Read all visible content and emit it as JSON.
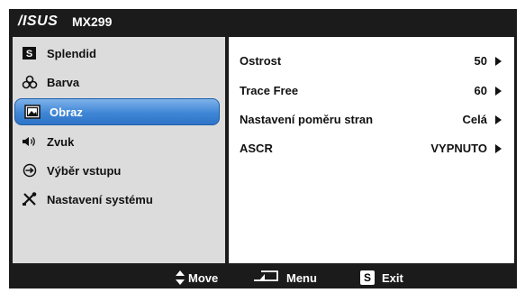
{
  "header": {
    "brand": "/ISUS",
    "model": "MX299"
  },
  "menu": [
    {
      "label": "Splendid",
      "icon": "splendid-s-icon",
      "active": false
    },
    {
      "label": "Barva",
      "icon": "color-icon",
      "active": false
    },
    {
      "label": "Obraz",
      "icon": "image-icon",
      "active": true
    },
    {
      "label": "Zvuk",
      "icon": "speaker-icon",
      "active": false
    },
    {
      "label": "Výběr vstupu",
      "icon": "input-icon",
      "active": false
    },
    {
      "label": "Nastavení systému",
      "icon": "tools-icon",
      "active": false
    }
  ],
  "settings": [
    {
      "name": "Ostrost",
      "value": "50"
    },
    {
      "name": "Trace Free",
      "value": "60"
    },
    {
      "name": "Nastavení poměru stran",
      "value": "Celá"
    },
    {
      "name": "ASCR",
      "value": "VYPNUTO"
    }
  ],
  "footer": {
    "move": "Move",
    "menu": "Menu",
    "exit_key": "S",
    "exit": "Exit"
  },
  "colors": {
    "active_blue": "#3f86d6",
    "panel_gray": "#dcdcdc",
    "bar_black": "#1b1b1b"
  }
}
